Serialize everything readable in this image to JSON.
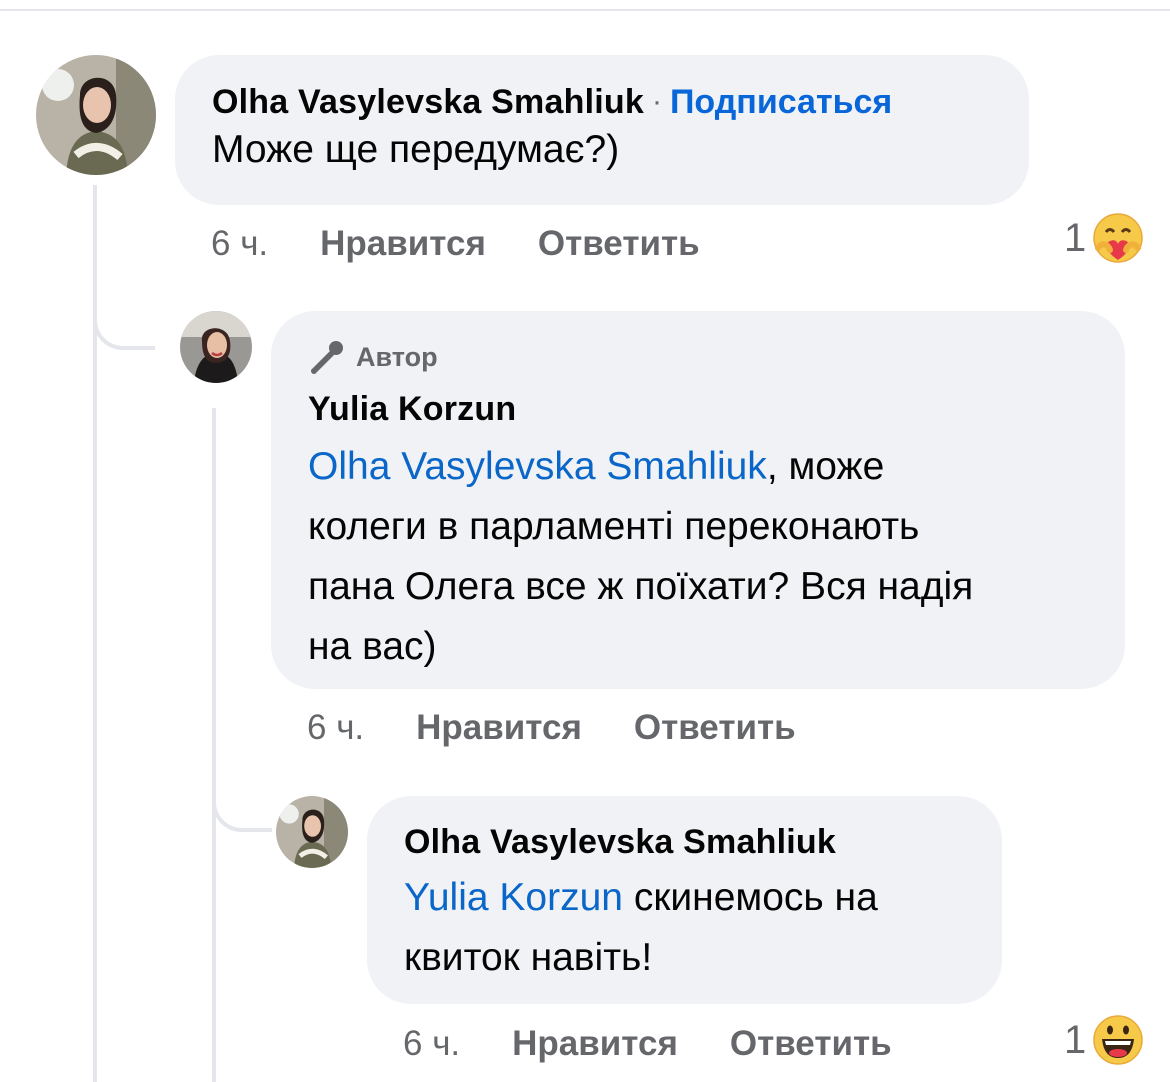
{
  "comments": [
    {
      "author": "Olha Vasylevska Smahliuk",
      "separator": "·",
      "subscribe_label": "Подписаться",
      "text": "Може ще передумає?)",
      "time": "6 ч.",
      "like_label": "Нравится",
      "reply_label": "Ответить",
      "reaction_count": "1",
      "reaction_icon": "care-reaction-icon"
    },
    {
      "badge": "Автор",
      "author": "Yulia Korzun",
      "mention": "Olha Vasylevska Smahliuk",
      "text_line1_rest": ", може",
      "text_line2": "колеги в парламенті переконають",
      "text_line3": "пана Олега все ж поїхати? Вся надія",
      "text_line4": "на вас)",
      "time": "6 ч.",
      "like_label": "Нравится",
      "reply_label": "Ответить"
    },
    {
      "author": "Olha Vasylevska Smahliuk",
      "mention": "Yulia Korzun",
      "text_line1_rest": " скинемось на",
      "text_line2": "квиток навіть!",
      "time": "6 ч.",
      "like_label": "Нравится",
      "reply_label": "Ответить",
      "reaction_count": "1",
      "reaction_icon": "haha-reaction-icon"
    }
  ],
  "colors": {
    "bubble": "#f0f2f5",
    "link": "#0866d8",
    "secondary_text": "#65676b",
    "thread_line": "#e4e6eb"
  }
}
